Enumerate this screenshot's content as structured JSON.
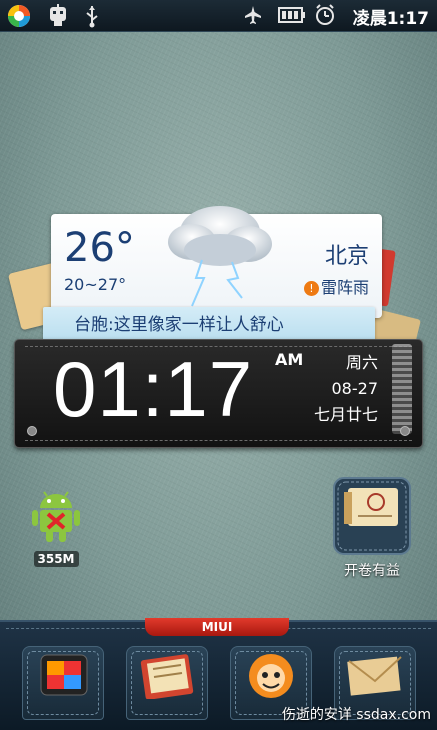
{
  "status_bar": {
    "time": "凌晨1:17"
  },
  "weather": {
    "temperature": "26°",
    "range": "20~27°",
    "city": "北京",
    "condition_icon": "!",
    "condition": "雷阵雨",
    "headline": "台胞:这里像家一样让人舒心"
  },
  "clock": {
    "time": "01:17",
    "ampm": "AM",
    "weekday": "周六",
    "date": "08-27",
    "lunar": "七月廿七"
  },
  "desktop": {
    "memory_label": "355M",
    "reader_label": "开卷有益"
  },
  "dock": {
    "brand": "MIUI"
  },
  "watermark": "伤逝的安详 ssdax.com"
}
